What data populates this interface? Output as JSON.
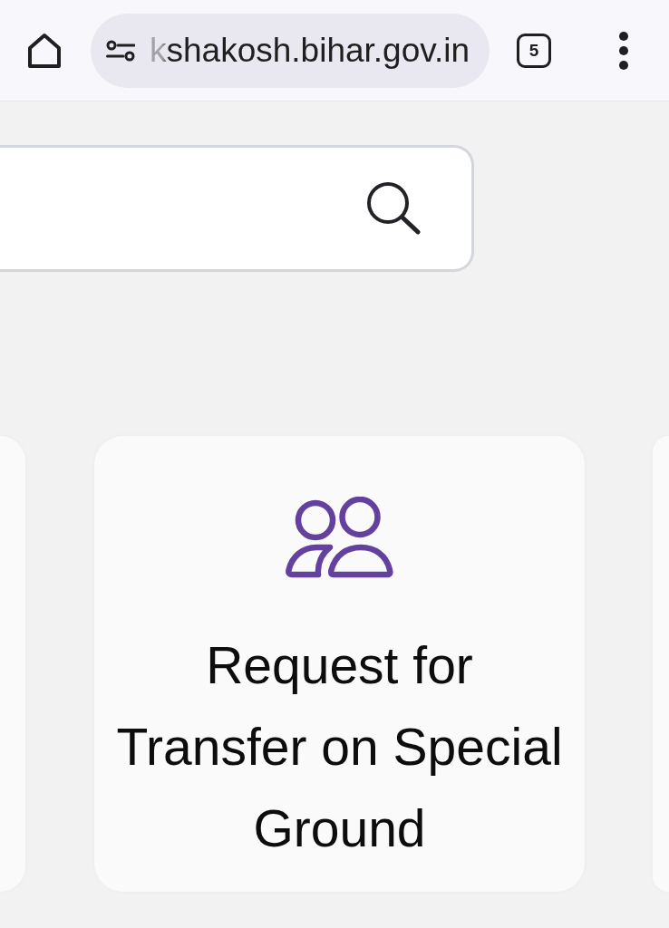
{
  "browser_bar": {
    "url": "kshakosh.bihar.gov.in",
    "tab_count": "5"
  },
  "cards": [
    {
      "kind": "cut"
    },
    {
      "kind": "full",
      "title": "Request for Transfer on Special Ground"
    },
    {
      "kind": "cut"
    }
  ]
}
